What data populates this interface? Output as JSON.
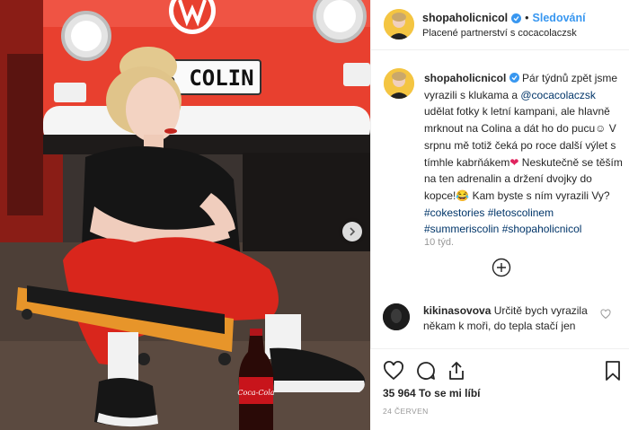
{
  "post": {
    "username": "shopaholicnicol",
    "dot": "•",
    "follow_label": "Sledování",
    "partnership": "Placené partnerství s cocacolaczsk",
    "caption": {
      "username": "shopaholicnicol",
      "text_1": "Pár týdnů zpět jsme vyrazili s klukama a",
      "mention": "@cocacolaczsk",
      "text_2": "udělat fotky k letní kampani, ale hlavně mrknout na Colina a dát ho do pucu☺ V srpnu mě totiž čeká po roce další výlet s tímhle kabrňákem",
      "heart": "❤",
      "text_3": "Neskutečně se těším na ten adrenalin a držení dvojky do kopce!😂 Kam byste s ním vyrazili Vy?",
      "tag_1": "#cokestories",
      "tag_2": "#letoscolinem",
      "tag_3": "#summeriscolin",
      "tag_4": "#shopaholicnicol"
    },
    "time_ago": "10 týd.",
    "comment": {
      "username": "kikinasovova",
      "text": "Určitě bych vyrazila někam k moři, do tepla stačí jen"
    },
    "likes": "35 964 To se mi líbí",
    "date": "24 červen"
  },
  "photo": {
    "plate_text": "3 COLIN",
    "bottle_label": "Coca-Cola",
    "colors": {
      "bus_red": "#e8402f",
      "pants_red": "#d9261c",
      "tshirt": "#151515",
      "creeper_orange": "#e7952a"
    }
  },
  "icons": {
    "verified": "verified-badge-icon",
    "carousel_next": "chevron-right-icon",
    "load_more": "plus-circle-icon",
    "comment_like": "heart-outline-icon",
    "like": "heart-icon",
    "comment": "comment-bubble-icon",
    "share": "share-icon",
    "save": "bookmark-icon"
  },
  "colors": {
    "accent_blue": "#3897f0",
    "link_dark_blue": "#003569",
    "muted_gray": "#999999",
    "border": "#efefef"
  }
}
